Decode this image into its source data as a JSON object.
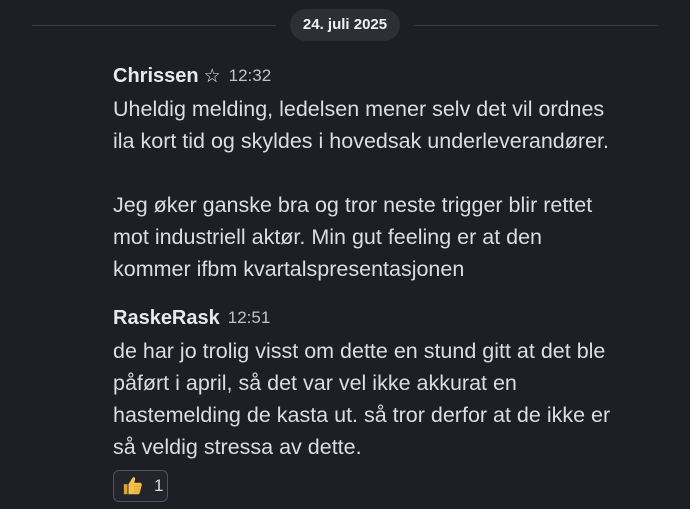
{
  "date_divider": "24. juli 2025",
  "messages": [
    {
      "author": "Chrissen",
      "badge_icon": "star-outline-icon",
      "time": "12:32",
      "lines": [
        "Uheldig melding, ledelsen mener selv det vil ordnes",
        "ila kort tid og skyldes i hovedsak underleverandører.",
        "",
        "Jeg øker ganske bra og tror neste trigger blir rettet",
        "mot industriell aktør. Min gut feeling er at den",
        "kommer ifbm kvartalspresentasjonen"
      ]
    },
    {
      "author": "RaskeRask",
      "time": "12:51",
      "lines": [
        "de har jo trolig visst om dette en stund gitt at det ble",
        "påført i april, så det var vel ikke akkurat en",
        "hastemelding de kasta ut. så tror derfor at de ikke er",
        "så veldig stressa av dette."
      ],
      "reaction": {
        "icon": "thumbs-up-icon",
        "count": "1"
      }
    }
  ]
}
